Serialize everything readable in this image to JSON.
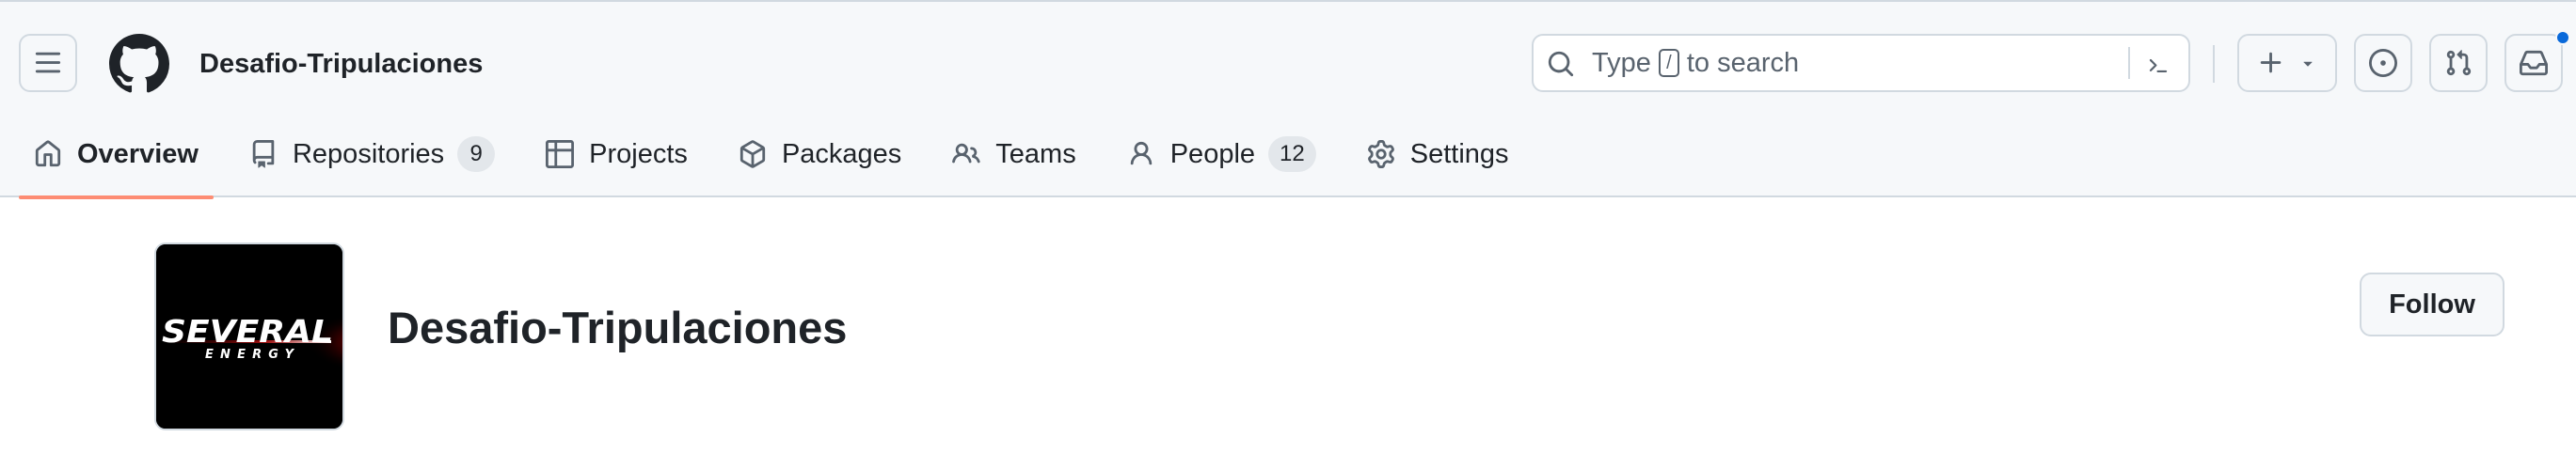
{
  "header": {
    "org_name": "Desafio-Tripulaciones",
    "search": {
      "prefix": "Type",
      "key": "/",
      "suffix": "to search"
    },
    "icons": [
      "three-bars-icon",
      "github-logo-icon",
      "search-icon",
      "command-palette-icon",
      "plus-icon",
      "triangle-down-icon",
      "issue-opened-icon",
      "git-pull-request-icon",
      "inbox-icon"
    ]
  },
  "tabs": [
    {
      "label": "Overview",
      "icon": "home-icon",
      "active": true
    },
    {
      "label": "Repositories",
      "icon": "repo-icon",
      "count": "9"
    },
    {
      "label": "Projects",
      "icon": "table-icon"
    },
    {
      "label": "Packages",
      "icon": "package-icon"
    },
    {
      "label": "Teams",
      "icon": "people-icon"
    },
    {
      "label": "People",
      "icon": "person-icon",
      "count": "12"
    },
    {
      "label": "Settings",
      "icon": "gear-icon"
    }
  ],
  "profile": {
    "name": "Desafio-Tripulaciones",
    "follow_label": "Follow",
    "avatar_logo": {
      "wordmark": "SEVERAL",
      "tagline": "ENERGY"
    }
  },
  "colors": {
    "header_bg": "#f6f8fa",
    "border": "#d1d9e0",
    "active_underline": "#fd8c73",
    "notification_dot": "#0969da",
    "counter_bg": "#e3e7eb"
  }
}
